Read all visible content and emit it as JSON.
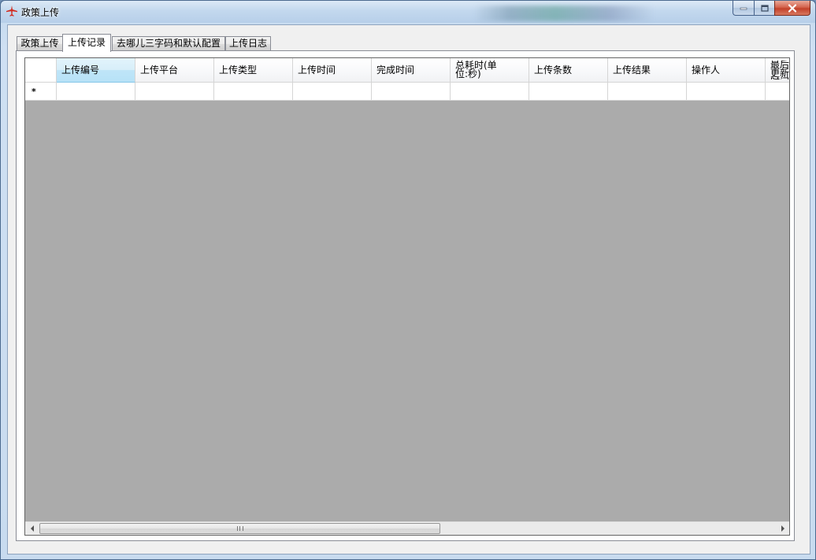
{
  "window": {
    "title": "政策上传",
    "icon": "airplane-icon",
    "controls": [
      "minimize-icon",
      "maximize-icon",
      "close-icon"
    ]
  },
  "tabs": [
    {
      "label": "政策上传",
      "active": false
    },
    {
      "label": "上传记录",
      "active": true
    },
    {
      "label": "去哪儿三字码和默认配置",
      "active": false
    },
    {
      "label": "上传日志",
      "active": false
    }
  ],
  "grid": {
    "columns": [
      "上传编号",
      "上传平台",
      "上传类型",
      "上传时间",
      "完成时间",
      "总耗时(单位:秒)",
      "上传条数",
      "上传结果",
      "操作人",
      "最后更新时间"
    ],
    "selected_column": "上传编号",
    "new_row_marker": "*",
    "rows": []
  },
  "scrollbar": {
    "grip": "III"
  },
  "colors": {
    "grid_background": "#ababab",
    "selected_header": "#bfe5f8",
    "close_button": "#c2412a"
  }
}
